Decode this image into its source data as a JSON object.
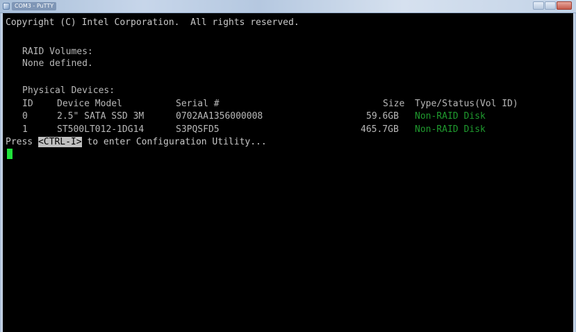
{
  "window": {
    "title": "COM3 - PuTTY"
  },
  "console": {
    "copyright": "Copyright (C) Intel Corporation.  All rights reserved.",
    "raid_header": "RAID Volumes:",
    "raid_none": "None defined.",
    "physical_header": "Physical Devices:",
    "columns": {
      "id": "ID",
      "model": "Device Model",
      "serial": "Serial #",
      "size": "Size",
      "type_status": "Type/Status(Vol ID)"
    },
    "devices": [
      {
        "id": "0",
        "model": "2.5\" SATA SSD 3M",
        "serial": "0702AA1356000008",
        "size": "59.6GB",
        "status": "Non-RAID Disk"
      },
      {
        "id": "1",
        "model": "ST500LT012-1DG14",
        "serial": "S3PQSFD5",
        "size": "465.7GB",
        "status": "Non-RAID Disk"
      }
    ],
    "prompt_prefix": "Press ",
    "prompt_key": "<CTRL-I>",
    "prompt_suffix": " to enter Configuration Utility..."
  },
  "colors": {
    "background": "#000000",
    "text": "#c8c8c8",
    "status_green": "#1f9a2e",
    "cursor_green": "#1fe23a",
    "key_highlight": "#c0c0c0"
  }
}
